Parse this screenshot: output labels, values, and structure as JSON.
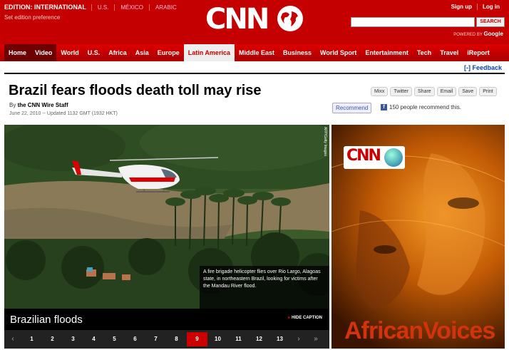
{
  "header": {
    "edition_label": "EDITION: INTERNATIONAL",
    "edition_links": [
      "U.S.",
      "MÉXICO",
      "ARABIC"
    ],
    "set_preference": "Set edition preference",
    "logo": "CNN",
    "signup": "Sign up",
    "login": "Log in",
    "search_button": "SEARCH",
    "powered_by": "POWERED BY",
    "powered_brand": "Google"
  },
  "nav": {
    "items": [
      "Home",
      "Video",
      "World",
      "U.S.",
      "Africa",
      "Asia",
      "Europe",
      "Latin America",
      "Middle East",
      "Business",
      "World Sport",
      "Entertainment",
      "Tech",
      "Travel",
      "iReport"
    ],
    "active": "Latin America"
  },
  "article": {
    "feedback": "[-] Feedback",
    "headline": "Brazil fears floods death toll may rise",
    "by": "By",
    "author": "the CNN Wire Staff",
    "date": "June 22, 2010 -- Updated 1132 GMT (1932 HKT)",
    "share_buttons": [
      "Mixx",
      "Twitter",
      "Share",
      "Email",
      "Save",
      "Print"
    ],
    "recommend": "Recommend",
    "recommend_count": "150 people recommend this."
  },
  "gallery": {
    "caption": "A fire brigade helicopter flies over Rio Largo, Alagoas state, in northeastern Brazil, looking for victims after the Mandau River flood.",
    "title": "Brazilian floods",
    "hide_caption": "HIDE CAPTION",
    "photo_credit": "AFP/Getty Images",
    "pages": [
      "1",
      "2",
      "3",
      "4",
      "5",
      "6",
      "7",
      "8",
      "9",
      "10",
      "11",
      "12",
      "13"
    ],
    "active_page": "9"
  },
  "ad": {
    "logo": "CNN",
    "title": "AfricanVoices"
  }
}
